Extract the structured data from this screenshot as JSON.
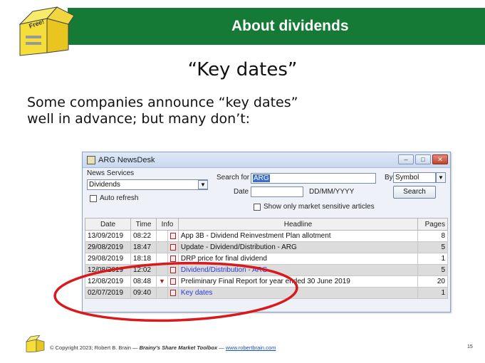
{
  "header": {
    "title": "About dividends",
    "band_color": "#157a35"
  },
  "logo": {
    "label": "Free!"
  },
  "slide": {
    "heading": "“Key dates”",
    "body_line1": "Some companies announce “key dates”",
    "body_line2": "well in advance; but many don’t:"
  },
  "app": {
    "title": "ARG NewsDesk",
    "news_services_label": "News Services",
    "news_services_value": "Dividends",
    "auto_refresh_label": "Auto refresh",
    "search_for_label": "Search for",
    "search_for_value": "ARG",
    "date_label": "Date",
    "date_value": "",
    "date_format": "DD/MM/YYYY",
    "by_label": "By",
    "by_value": "Symbol",
    "search_button": "Search",
    "market_sensitive_label": "Show only market sensitive articles",
    "columns": [
      "Date",
      "Time",
      "Info",
      "Headline",
      "Pages"
    ],
    "rows": [
      {
        "date": "13/09/2019",
        "time": "08:22",
        "flag": "",
        "headline": "App 3B - Dividend Reinvestment Plan allotment",
        "pages": "8"
      },
      {
        "date": "29/08/2019",
        "time": "18:47",
        "flag": "",
        "headline": "Update - Dividend/Distribution - ARG",
        "pages": "5"
      },
      {
        "date": "29/08/2019",
        "time": "18:18",
        "flag": "",
        "headline": "DRP price for final dividend",
        "pages": "1"
      },
      {
        "date": "12/08/2019",
        "time": "12:02",
        "flag": "",
        "headline": "Dividend/Distribution - ARG",
        "pages": "5"
      },
      {
        "date": "12/08/2019",
        "time": "08:48",
        "flag": "flag",
        "headline": "Preliminary Final Report for year ended 30 June 2019",
        "pages": "20"
      },
      {
        "date": "02/07/2019",
        "time": "09:40",
        "flag": "",
        "headline": "Key dates",
        "pages": "1"
      }
    ]
  },
  "footer": {
    "copyright": "© Copyright 2023; Robert B. Brain — ",
    "book": "Brainy’s Share Market Toolbox",
    "sep": " — ",
    "url": "www.robertbrain.com",
    "page": "15"
  },
  "colors": {
    "annotation": "#d9191c",
    "link": "#2a3bd6"
  }
}
